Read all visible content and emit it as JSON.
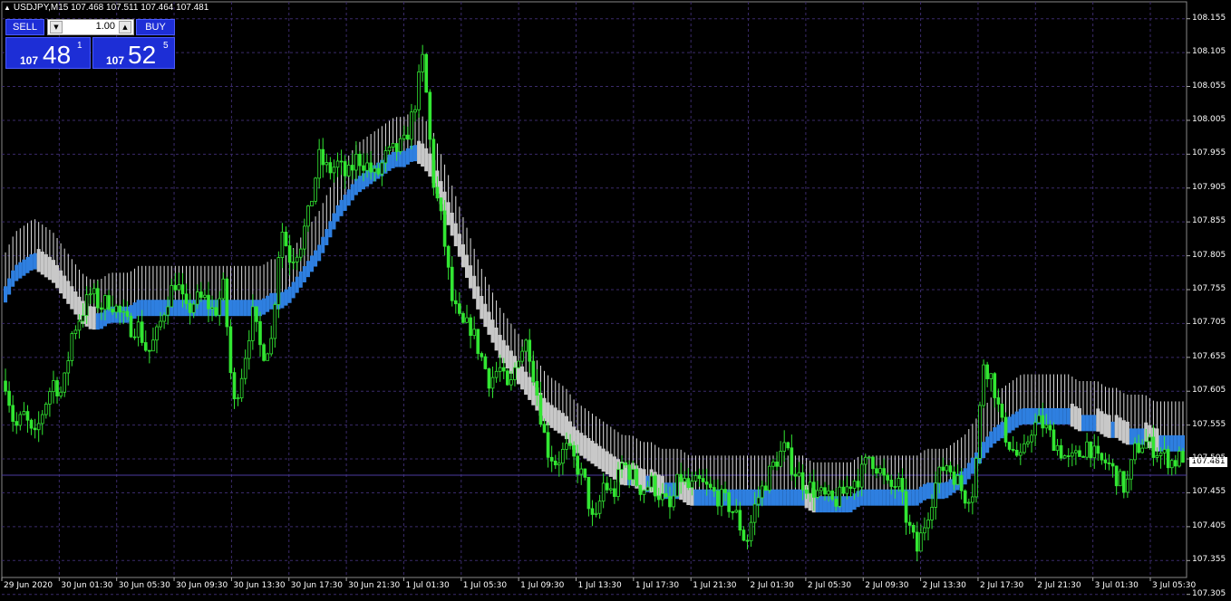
{
  "header": {
    "symbol_line": "USDJPY,M15  107.468 107.511 107.464 107.481"
  },
  "trade_panel": {
    "sell_label": "SELL",
    "buy_label": "BUY",
    "lot_value": "1.00",
    "bid": {
      "prefix": "107",
      "big": "48",
      "sup": "1"
    },
    "ask": {
      "prefix": "107",
      "big": "52",
      "sup": "5"
    }
  },
  "chart_data": {
    "type": "candlestick",
    "symbol": "USDJPY",
    "timeframe": "M15",
    "ohlc_last": {
      "open": 107.468,
      "high": 107.511,
      "low": 107.464,
      "close": 107.481
    },
    "current_price": "107.481",
    "ylim": [
      107.33,
      108.18
    ],
    "grid": true,
    "y_ticks": [
      "108.155",
      "108.105",
      "108.055",
      "108.005",
      "107.955",
      "107.905",
      "107.855",
      "107.805",
      "107.755",
      "107.705",
      "107.655",
      "107.605",
      "107.555",
      "107.505",
      "107.455",
      "107.405",
      "107.355",
      "107.305"
    ],
    "x_ticks": [
      "29 Jun 2020",
      "30 Jun 01:30",
      "30 Jun 05:30",
      "30 Jun 09:30",
      "30 Jun 13:30",
      "30 Jun 17:30",
      "30 Jun 21:30",
      "1 Jul 01:30",
      "1 Jul 05:30",
      "1 Jul 09:30",
      "1 Jul 13:30",
      "1 Jul 17:30",
      "1 Jul 21:30",
      "2 Jul 01:30",
      "2 Jul 05:30",
      "2 Jul 09:30",
      "2 Jul 13:30",
      "2 Jul 17:30",
      "2 Jul 21:30",
      "3 Jul 01:30",
      "3 Jul 05:30"
    ],
    "price_path": [
      107.62,
      107.55,
      107.57,
      107.53,
      107.58,
      107.62,
      107.6,
      107.69,
      107.72,
      107.75,
      107.73,
      107.74,
      107.72,
      107.7,
      107.7,
      107.66,
      107.69,
      107.74,
      107.77,
      107.72,
      107.74,
      107.74,
      107.72,
      107.76,
      107.58,
      107.64,
      107.72,
      107.66,
      107.68,
      107.85,
      107.8,
      107.82,
      107.87,
      107.95,
      107.93,
      107.94,
      107.92,
      107.95,
      107.94,
      107.92,
      107.95,
      107.96,
      107.97,
      108.02,
      108.1,
      107.92,
      107.85,
      107.74,
      107.7,
      107.7,
      107.66,
      107.62,
      107.64,
      107.6,
      107.66,
      107.68,
      107.6,
      107.52,
      107.5,
      107.52,
      107.5,
      107.47,
      107.4,
      107.47,
      107.45,
      107.5,
      107.48,
      107.46,
      107.47,
      107.45,
      107.43,
      107.48,
      107.46,
      107.47,
      107.46,
      107.45,
      107.44,
      107.42,
      107.38,
      107.44,
      107.47,
      107.5,
      107.52,
      107.49,
      107.47,
      107.46,
      107.45,
      107.44,
      107.45,
      107.47,
      107.48,
      107.51,
      107.49,
      107.46,
      107.47,
      107.41,
      107.37,
      107.42,
      107.47,
      107.5,
      107.48,
      107.45,
      107.46,
      107.65,
      107.62,
      107.55,
      107.52,
      107.5,
      107.55,
      107.56,
      107.54,
      107.52,
      107.5,
      107.51,
      107.53,
      107.5,
      107.5,
      107.48,
      107.46,
      107.52,
      107.53,
      107.52,
      107.51,
      107.5,
      107.51
    ],
    "ma_path": [
      107.74,
      107.77,
      107.78,
      107.79,
      107.78,
      107.77,
      107.75,
      107.73,
      107.71,
      107.7,
      107.7,
      107.71,
      107.71,
      107.71,
      107.72,
      107.72,
      107.72,
      107.72,
      107.72,
      107.72,
      107.72,
      107.72,
      107.72,
      107.72,
      107.72,
      107.72,
      107.72,
      107.72,
      107.73,
      107.73,
      107.74,
      107.76,
      107.78,
      107.8,
      107.83,
      107.86,
      107.88,
      107.9,
      107.91,
      107.92,
      107.93,
      107.94,
      107.94,
      107.95,
      107.94,
      107.92,
      107.88,
      107.84,
      107.8,
      107.76,
      107.72,
      107.69,
      107.66,
      107.64,
      107.62,
      107.6,
      107.58,
      107.56,
      107.55,
      107.54,
      107.52,
      107.51,
      107.5,
      107.49,
      107.48,
      107.47,
      107.47,
      107.46,
      107.46,
      107.45,
      107.45,
      107.45,
      107.44,
      107.44,
      107.44,
      107.44,
      107.44,
      107.44,
      107.44,
      107.44,
      107.44,
      107.44,
      107.44,
      107.44,
      107.44,
      107.43,
      107.43,
      107.43,
      107.43,
      107.43,
      107.44,
      107.44,
      107.44,
      107.44,
      107.44,
      107.44,
      107.44,
      107.45,
      107.45,
      107.45,
      107.46,
      107.47,
      107.49,
      107.51,
      107.53,
      107.54,
      107.55,
      107.56,
      107.56,
      107.56,
      107.56,
      107.56,
      107.56,
      107.55,
      107.55,
      107.55,
      107.54,
      107.54,
      107.53,
      107.53,
      107.53,
      107.52,
      107.52,
      107.52,
      107.52
    ],
    "colors": {
      "background": "#000000",
      "candle": "#32e632",
      "grid": "#3a2a6a",
      "ma_up": "#2e7fe0",
      "ma_down": "#c8c8c8",
      "envelope": "#e0e0e0",
      "price_line": "#4b3aa0"
    }
  }
}
